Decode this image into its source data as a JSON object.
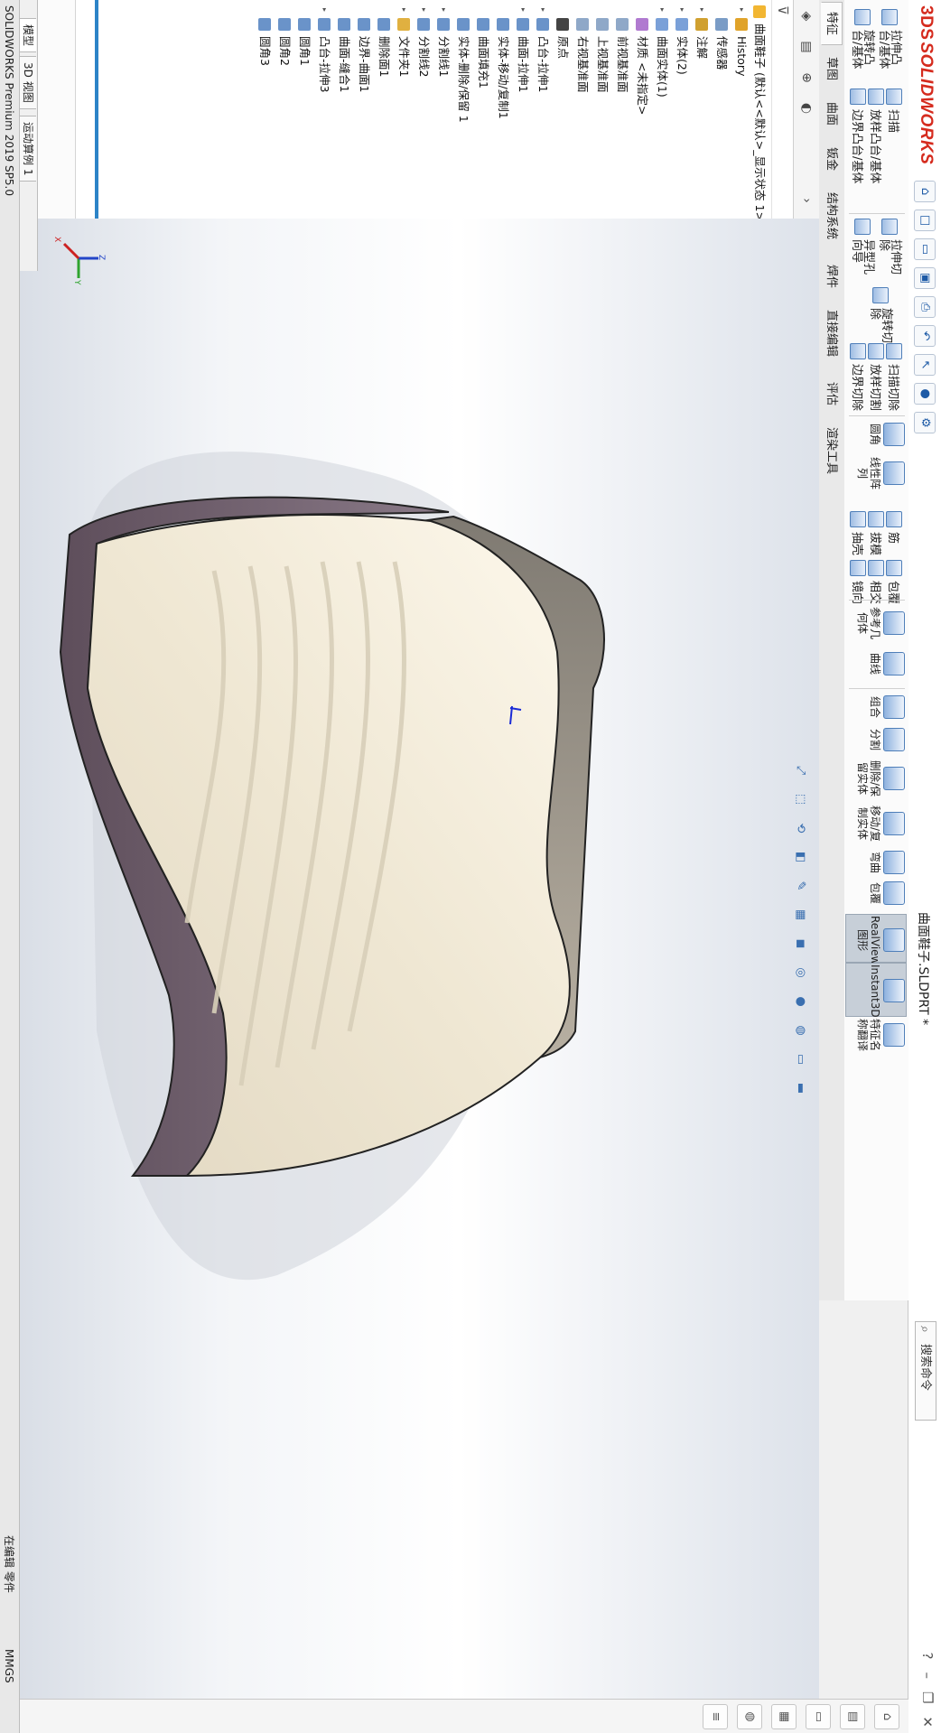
{
  "app": {
    "logo_text": "SOLIDWORKS",
    "logo_prefix": "3DS",
    "document_title": "曲面鞋子.SLDPRT *",
    "search_placeholder": "搜索命令",
    "status_left": "SOLIDWORKS Premium 2019 SP5.0",
    "status_middle": "在编辑 零件",
    "status_right": "MMGS",
    "brand_color": "#d52b1e",
    "accent_color": "#2c83c7"
  },
  "quick_access": [
    "home-icon",
    "new-icon",
    "open-icon",
    "save-icon",
    "print-icon",
    "undo-icon",
    "select-icon",
    "rebuild-icon",
    "options-icon"
  ],
  "window_controls": [
    "help-icon",
    "minimize-icon",
    "restore-icon",
    "close-icon"
  ],
  "commands": {
    "extrude_boss": "拉伸凸\n台/基体",
    "revolve_boss": "旋转凸\n台/基体",
    "sweep": "扫描",
    "loft": "放样凸台/基体",
    "boundary_boss": "边界凸台/基体",
    "extrude_cut": "拉伸切\n除",
    "hole_wizard": "异型孔\n向导",
    "revolve_cut": "旋转切\n除",
    "sweep_cut": "扫描切除",
    "loft_cut": "放样切割",
    "boundary_cut": "边界切除",
    "fillet": "圆角",
    "linear_pattern": "线性阵\n列",
    "rib": "筋",
    "draft": "拔模",
    "shell": "抽壳",
    "wrap": "包覆",
    "intersect": "相交",
    "mirror": "镜向",
    "ref_geometry": "参考几\n何体",
    "curves": "曲线",
    "combine": "组合",
    "split": "分割",
    "delete_keep_body": "删除/保\n留实体",
    "move_copy_body": "移动/复\n制实体",
    "flex": "弯曲",
    "indent": "包覆",
    "realview": "RealView\n图形",
    "instant3d": "Instant3D",
    "feature_paint": "特征名\n称翻译"
  },
  "tabs": [
    "特征",
    "草图",
    "曲面",
    "钣金",
    "结构系统",
    "焊件",
    "直接编辑",
    "评估",
    "渲染工具"
  ],
  "active_tab": "特征",
  "feature_tree": {
    "root": "曲面鞋子 (默认<<默认>_显示状态 1>)",
    "items": [
      {
        "label": "History",
        "icon": "history-icon",
        "expand": "▸"
      },
      {
        "label": "传感器",
        "icon": "sensor-icon",
        "expand": ""
      },
      {
        "label": "注解",
        "icon": "annotation-icon",
        "expand": "▸"
      },
      {
        "label": "实体(2)",
        "icon": "solid-bodies-icon",
        "expand": "▸"
      },
      {
        "label": "曲面实体(1)",
        "icon": "surface-bodies-icon",
        "expand": "▸"
      },
      {
        "label": "材质 <未指定>",
        "icon": "material-icon",
        "expand": ""
      },
      {
        "label": "前视基准面",
        "icon": "plane-icon",
        "expand": ""
      },
      {
        "label": "上视基准面",
        "icon": "plane-icon",
        "expand": ""
      },
      {
        "label": "右视基准面",
        "icon": "plane-icon",
        "expand": ""
      },
      {
        "label": "原点",
        "icon": "origin-icon",
        "expand": ""
      },
      {
        "label": "凸台-拉伸1",
        "icon": "extrude-icon",
        "expand": "▸"
      },
      {
        "label": "曲面-拉伸1",
        "icon": "surface-extrude-icon",
        "expand": "▸"
      },
      {
        "label": "实体-移动/复制1",
        "icon": "move-body-icon",
        "expand": ""
      },
      {
        "label": "曲面填充1",
        "icon": "fill-surface-icon",
        "expand": ""
      },
      {
        "label": "实体-删除/保留 1",
        "icon": "delete-body-icon",
        "expand": ""
      },
      {
        "label": "分割线1",
        "icon": "split-line-icon",
        "expand": "▸"
      },
      {
        "label": "分割线2",
        "icon": "split-line-icon",
        "expand": "▸"
      },
      {
        "label": "文件夹1",
        "icon": "folder-icon",
        "expand": "▸"
      },
      {
        "label": "删除面1",
        "icon": "delete-face-icon",
        "expand": ""
      },
      {
        "label": "边界-曲面1",
        "icon": "boundary-surface-icon",
        "expand": ""
      },
      {
        "label": "曲面-缝合1",
        "icon": "knit-icon",
        "expand": ""
      },
      {
        "label": "凸台-拉伸3",
        "icon": "extrude-icon",
        "expand": "▸"
      },
      {
        "label": "圆角1",
        "icon": "fillet-icon",
        "expand": ""
      },
      {
        "label": "圆角2",
        "icon": "fillet-icon",
        "expand": ""
      },
      {
        "label": "圆角3",
        "icon": "fillet-icon",
        "expand": ""
      }
    ]
  },
  "bottom_tabs": [
    "模型",
    "3D 视图",
    "运动算例 1"
  ],
  "active_bottom_tab": "模型",
  "graphics": {
    "view_icons": [
      "zoom-fit-icon",
      "zoom-area-icon",
      "previous-view-icon",
      "section-view-icon",
      "dynamic-annotation-icon",
      "view-orientation-icon",
      "display-style-icon",
      "hide-show-icon",
      "edit-appearance-icon",
      "apply-scene-icon",
      "view-settings-icon",
      "monitor-icon"
    ],
    "triad_labels": [
      "X",
      "Y",
      "Z"
    ]
  },
  "task_pane": [
    "resources-icon",
    "design-library-icon",
    "file-explorer-icon",
    "view-palette-icon",
    "appearances-icon",
    "custom-properties-icon"
  ]
}
